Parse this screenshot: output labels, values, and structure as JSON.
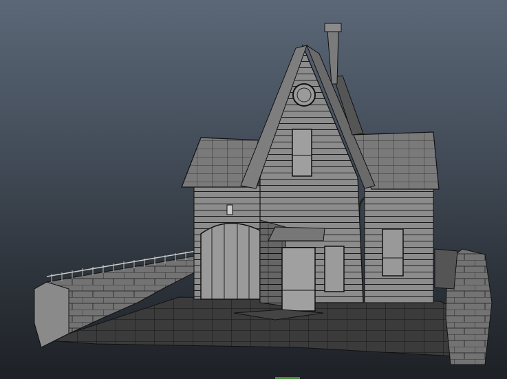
{
  "viewport": {
    "mode": "wireframe-on-shaded",
    "background": "gradient-grey-blue",
    "subject": "house"
  },
  "colors": {
    "background_top": "#5b6777",
    "background_bottom": "#1d2126",
    "wall": "#8d8d8d",
    "wall_dark": "#5e5e5e",
    "roof": "#7b7b7b",
    "ground": "#3a3a3a",
    "wire": "#141414"
  }
}
